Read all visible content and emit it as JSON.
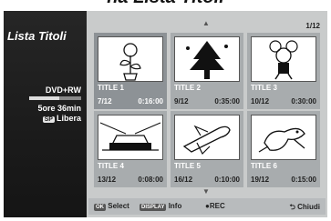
{
  "heading": "na Lista Titoli",
  "sidebar": {
    "title": "Lista Titoli",
    "disc": "DVD+RW",
    "remaining": "5ore 36min",
    "mode_badge": "SP",
    "free_label": "Libera",
    "capacity_used_fraction": 0.58
  },
  "page_indicator": "1/12",
  "titles": [
    {
      "name": "TITLE 1",
      "date": "7/12",
      "length": "0:16:00",
      "icon": "flower-pot-icon"
    },
    {
      "name": "TITLE 2",
      "date": "9/12",
      "length": "0:35:00",
      "icon": "tree-icon"
    },
    {
      "name": "TITLE 3",
      "date": "10/12",
      "length": "0:30:00",
      "icon": "cartoon-mouse-icon"
    },
    {
      "name": "TITLE 4",
      "date": "13/12",
      "length": "0:08:00",
      "icon": "car-icon"
    },
    {
      "name": "TITLE 5",
      "date": "16/12",
      "length": "0:10:00",
      "icon": "space-shuttle-icon"
    },
    {
      "name": "TITLE 6",
      "date": "19/12",
      "length": "0:15:00",
      "icon": "cartoon-dog-icon"
    }
  ],
  "footer": {
    "ok_key": "OK",
    "select": "Select",
    "display_key": "DISPLAY",
    "info": "Info",
    "rec": "●REC",
    "back": "Chiudi"
  },
  "colors": {
    "selected_thumb": "#8d9296",
    "panel": "#c9cbcb",
    "sidebar": "#1e1e1e"
  }
}
